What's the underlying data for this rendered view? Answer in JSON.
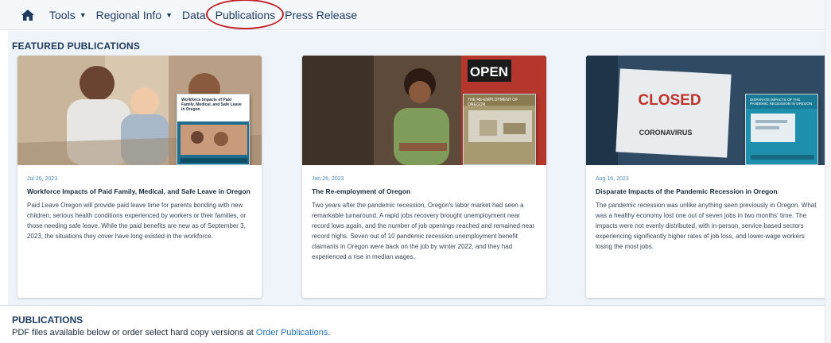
{
  "nav": {
    "home_icon": "home-icon",
    "items": [
      {
        "label": "Tools",
        "has_dropdown": true
      },
      {
        "label": "Regional Info",
        "has_dropdown": true
      },
      {
        "label": "Data",
        "has_dropdown": false
      },
      {
        "label": "Publications",
        "has_dropdown": false,
        "circled": true
      },
      {
        "label": "Press Release",
        "has_dropdown": false
      }
    ]
  },
  "featured": {
    "title": "FEATURED PUBLICATIONS",
    "cards": [
      {
        "date": "Jul 26, 2023",
        "title": "Workforce Impacts of Paid Family, Medical, and Safe Leave in Oregon",
        "description": "Paid Leave Oregon will provide paid leave time for parents bonding with new children, serious health conditions experienced by workers or their families, or those needing safe leave. While the paid benefits are new as of September 3, 2023, the situations they cover have long existed in the workforce.",
        "cover_title": "Workforce Impacts of Paid Family, Medical, and Safe Leave in Oregon"
      },
      {
        "date": "Jan 26, 2023",
        "title": "The Re-employment of Oregon",
        "description": "Two years after the pandemic recession, Oregon's labor market had seen a remarkable turnaround. A rapid jobs recovery brought unemployment near record lows again, and the number of job openings reached and remained near record highs. Seven out of 10 pandemic recession unemployment benefit claimants in Oregon were back on the job by winter 2022, and they had experienced a rise in median wages.",
        "cover_title": "THE RE-EMPLOYMENT OF OREGON",
        "sign_text": "OPEN"
      },
      {
        "date": "Aug 16, 2023",
        "title": "Disparate Impacts of the Pandemic Recession in Oregon",
        "description": "The pandemic recession was unlike anything seen previously in Oregon. What was a healthy economy lost one out of seven jobs in two months' time. The impacts were not evenly distributed, with in-person, service-based sectors experiencing significantly higher rates of job loss, and lower-wage workers losing the most jobs.",
        "cover_title": "DISPARATE IMPACTS OF THE PANDEMIC RECESSION IN OREGON",
        "sign_text": "CLOSED",
        "sign_sub": "CORONAVIRUS"
      }
    ]
  },
  "publications": {
    "title": "PUBLICATIONS",
    "text": "PDF files available below or order select hard copy versions at ",
    "link_label": "Order Publications",
    "text_end": "."
  },
  "colors": {
    "nav_text": "#1e3a5f",
    "highlight_circle": "#c21f26",
    "link": "#1f6fb8",
    "date": "#4a8ab8",
    "featured_bg": "#eef4f9"
  }
}
